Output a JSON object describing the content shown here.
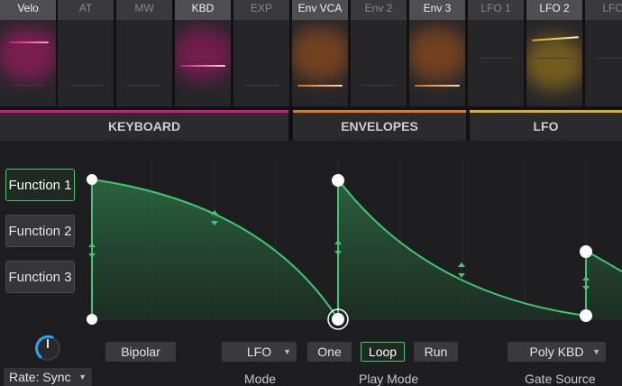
{
  "sources": [
    {
      "label": "Velo",
      "active": true
    },
    {
      "label": "AT",
      "active": false
    },
    {
      "label": "MW",
      "active": false
    },
    {
      "label": "KBD",
      "active": true
    },
    {
      "label": "EXP",
      "active": false
    },
    {
      "label": "Env VCA",
      "active": true
    },
    {
      "label": "Env 2",
      "active": false
    },
    {
      "label": "Env 3",
      "active": true
    },
    {
      "label": "LFO 1",
      "active": false
    },
    {
      "label": "LFO 2",
      "active": true
    },
    {
      "label": "LFO",
      "active": false
    }
  ],
  "sections": {
    "keyboard": "KEYBOARD",
    "envelopes": "ENVELOPES",
    "lfo": "LFO"
  },
  "colors": {
    "keyboard": "#d6157d",
    "envelopes": "#e07a1c",
    "lfo": "#e0ac1f",
    "accent": "#3fc86f"
  },
  "functions": {
    "f1": "Function 1",
    "f2": "Function 2",
    "f3": "Function 3",
    "selected": "Function 1"
  },
  "controls": {
    "bipolar": "Bipolar",
    "mode_value": "LFO",
    "mode_label": "Mode",
    "one": "One",
    "loop": "Loop",
    "run": "Run",
    "play_mode_label": "Play Mode",
    "gate_value": "Poly KBD",
    "gate_label": "Gate Source",
    "rate": "Rate: Sync",
    "play_mode_selected": "Loop"
  },
  "icons": {
    "dropdown": "chevron-down-icon",
    "knob": "rate-knob-icon",
    "breakpoint": "breakpoint-handle-icon",
    "curve": "curve-handle-icon"
  }
}
